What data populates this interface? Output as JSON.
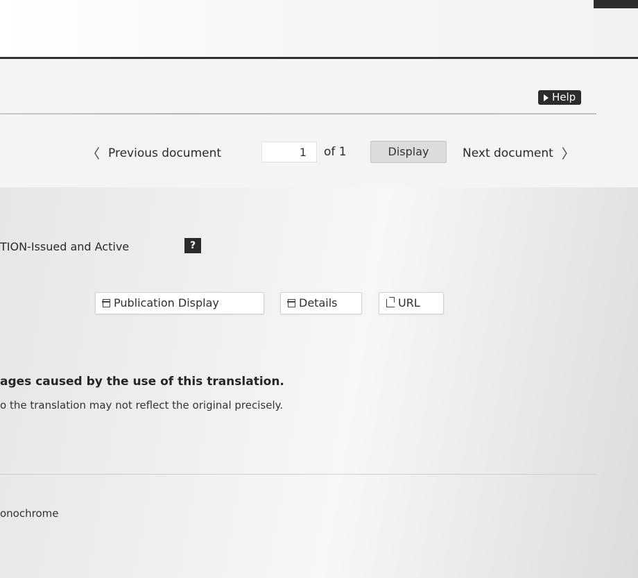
{
  "header": {
    "help_label": "Help"
  },
  "navigation": {
    "previous_label": "Previous document",
    "page_value": "1",
    "of_total": "of 1",
    "display_label": "Display",
    "next_label": "Next document",
    "prev_chevron": "〈",
    "next_chevron": "〉"
  },
  "document": {
    "status_text": "TION-Issued and Active",
    "status_help_icon": "?",
    "actions": {
      "publication_display": "Publication Display",
      "details": "Details",
      "url": "URL"
    },
    "disclaimer_bold": "ages caused by the use of this translation.",
    "disclaimer_note": "o the translation may not reflect the original precisely.",
    "color_mode": "onochrome"
  }
}
